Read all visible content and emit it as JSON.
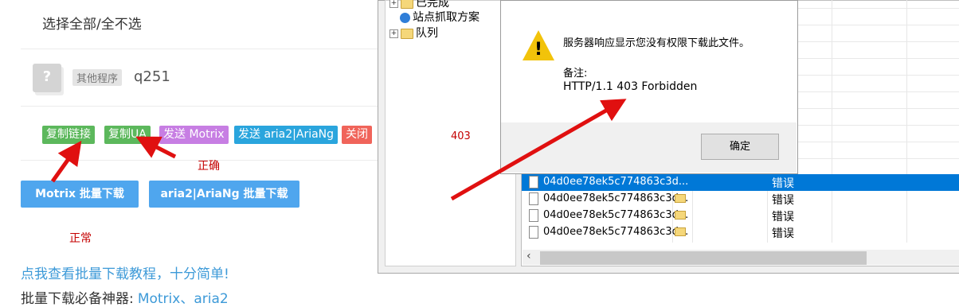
{
  "page": {
    "select_all": "选择全部/全不选",
    "file": {
      "tag": "其他程序",
      "name": "q251",
      "avatar_glyph": "?"
    },
    "buttons": [
      {
        "label": "复制链接",
        "color": "#5cb85c"
      },
      {
        "label": "复制UA",
        "color": "#5cb85c"
      },
      {
        "label": "发送 Motrix",
        "color": "#c77ee3"
      },
      {
        "label": "发送 aria2|AriaNg",
        "color": "#2aa5dd"
      },
      {
        "label": "关闭",
        "color": "#f0645a"
      }
    ],
    "batch_motrix": "Motrix 批量下载",
    "batch_aria2": "aria2|AriaNg 批量下载",
    "note_correct": "正确",
    "note_normal": "正常",
    "note_403": "403",
    "tutorial_link": "点我查看批量下载教程，十分简单!",
    "tools_prefix": "批量下载必备神器:",
    "tools_link": "Motrix、aria2"
  },
  "app": {
    "tree": [
      {
        "label": "已完成",
        "icon": "check-folder-icon"
      },
      {
        "label": "站点抓取方案",
        "icon": "globe-icon"
      },
      {
        "label": "队列",
        "icon": "folder-icon"
      }
    ],
    "rows": [
      {
        "name": "04d0ee78ek5c774863c3d...",
        "status": "错误",
        "selected": true
      },
      {
        "name": "04d0ee78ek5c774863c3d...",
        "status": "错误",
        "selected": false
      },
      {
        "name": "04d0ee78ek5c774863c3d...",
        "status": "错误",
        "selected": false
      },
      {
        "name": "04d0ee78ek5c774863c3d...",
        "status": "错误",
        "selected": false
      }
    ]
  },
  "dialog": {
    "message": "服务器响应显示您没有权限下载此文件。",
    "note_label": "备注:",
    "note_detail": "HTTP/1.1 403 Forbidden",
    "ok_label": "确定",
    "icon": "warning-icon"
  },
  "colors": {
    "annotation_arrow": "#e01010",
    "selection": "#0078d7",
    "link": "#3d9ad8"
  }
}
